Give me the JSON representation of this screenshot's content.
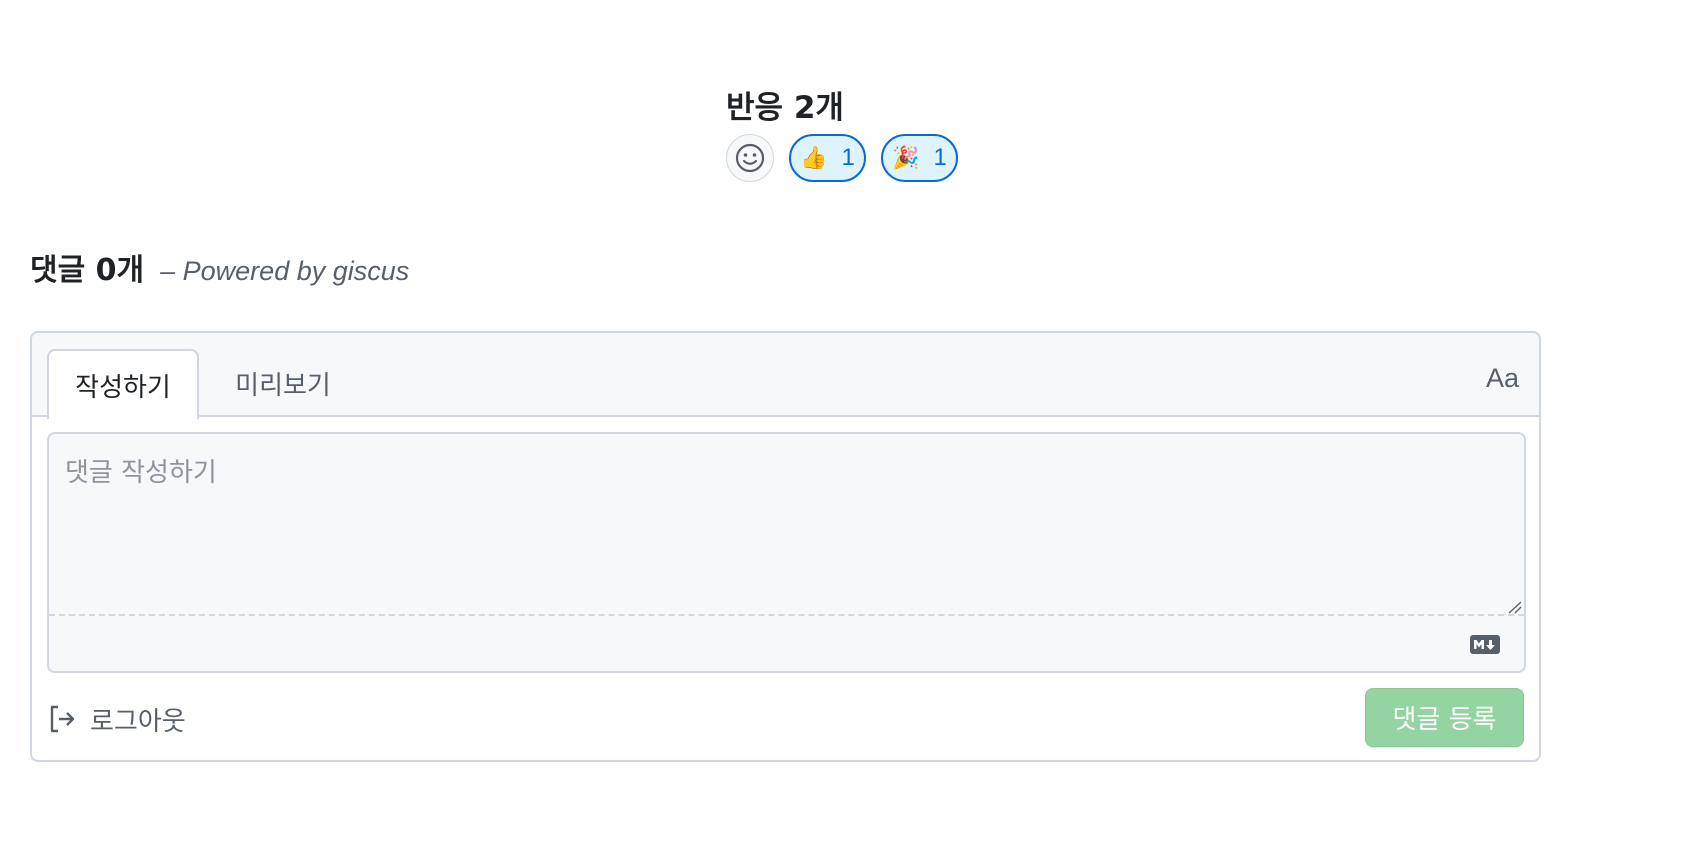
{
  "reactions": {
    "title": "반응 2개",
    "add_icon": "smiley-icon",
    "items": [
      {
        "emoji": "👍",
        "icon": "thumbs-up-icon",
        "count": "1"
      },
      {
        "emoji": "🎉",
        "icon": "party-popper-icon",
        "count": "1"
      }
    ]
  },
  "comments": {
    "count_label": "댓글 0개",
    "powered_by": "– Powered by giscus"
  },
  "editor": {
    "tab_write": "작성하기",
    "tab_preview": "미리보기",
    "font_toggle": "Aa",
    "placeholder": "댓글 작성하기",
    "markdown_icon": "markdown-icon",
    "logout_icon": "sign-out-icon",
    "logout_label": "로그아웃",
    "submit_label": "댓글 등록"
  },
  "colors": {
    "accent": "#0969da",
    "reaction_bg": "#ddf4ff",
    "submit_disabled": "#94d3a2",
    "border": "#d0d7de"
  }
}
